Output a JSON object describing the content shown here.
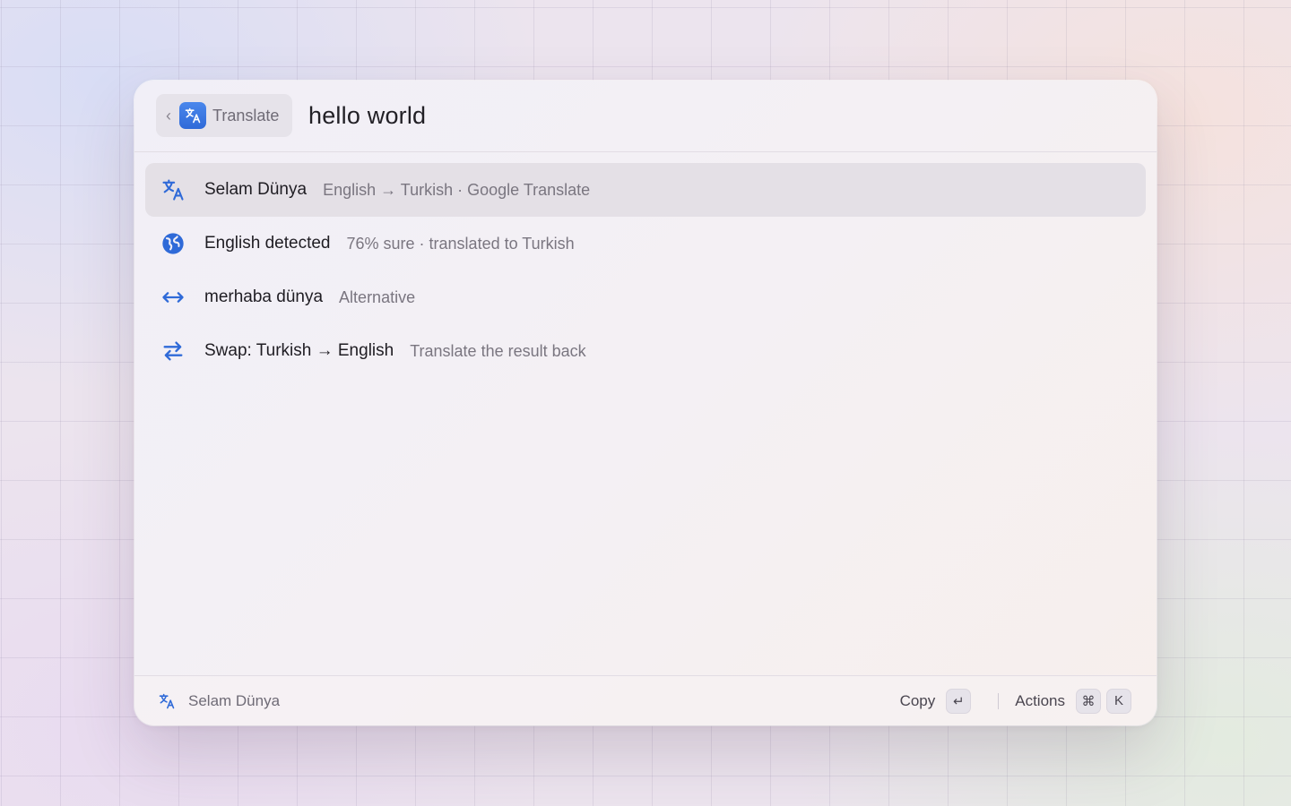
{
  "header": {
    "back_chevron": "‹",
    "extension_label": "Translate",
    "query": "hello world"
  },
  "results": [
    {
      "title": "Selam Dünya",
      "subtitle": "English → Turkish · Google Translate",
      "icon": "translate-icon",
      "selected": true
    },
    {
      "title": "English detected",
      "subtitle": "76% sure · translated to Turkish",
      "icon": "globe-icon"
    },
    {
      "title": "merhaba dünya",
      "subtitle": "Alternative",
      "icon": "arrow-left-right-icon"
    },
    {
      "title": "Swap: Turkish → English",
      "subtitle": "Translate the result back",
      "icon": "swap-icon"
    }
  ],
  "footer": {
    "selection_label": "Selam Dünya",
    "primary_action": "Copy",
    "primary_key": "↵",
    "actions_label": "Actions",
    "actions_keys": [
      "⌘",
      "K"
    ]
  },
  "colors": {
    "accent": "#2f6ad8"
  }
}
